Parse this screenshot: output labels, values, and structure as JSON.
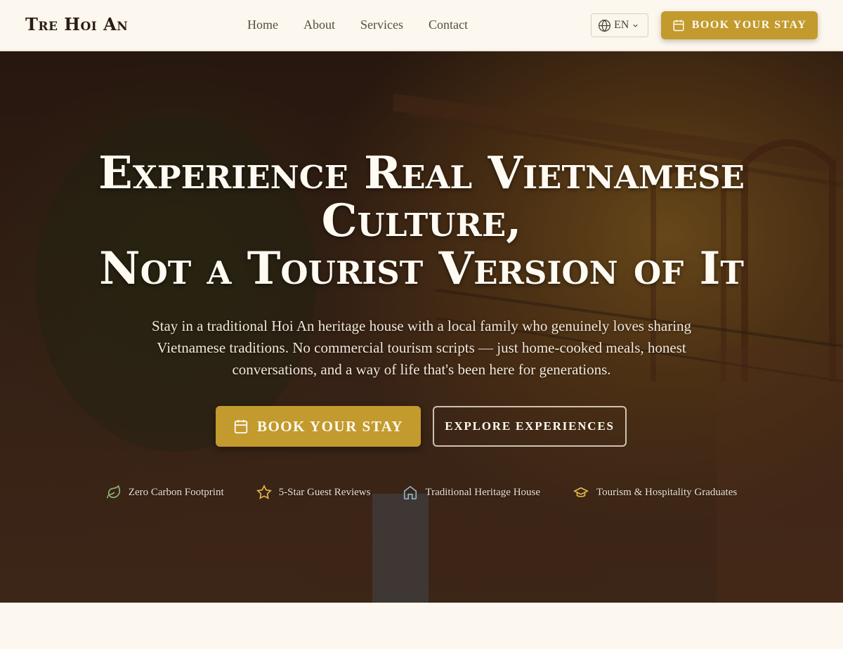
{
  "header": {
    "brand": "Tre Hoi An",
    "nav": [
      "Home",
      "About",
      "Services",
      "Contact"
    ],
    "language": "EN",
    "book_label": "BOOK YOUR STAY"
  },
  "hero": {
    "title_lines": [
      "Experience Real Vietnamese",
      "Culture,",
      "Not a Tourist Version of It"
    ],
    "subtitle": "Stay in a traditional Hoi An heritage house with a local family who genuinely loves sharing Vietnamese traditions. No commercial tourism scripts — just home-cooked meals, honest conversations, and a way of life that's been here for generations.",
    "book_label": "BOOK YOUR STAY",
    "explore_label": "EXPLORE EXPERIENCES",
    "features": [
      {
        "icon": "leaf-icon",
        "label": "Zero Carbon Footprint"
      },
      {
        "icon": "star-icon",
        "label": "5-Star Guest Reviews"
      },
      {
        "icon": "house-icon",
        "label": "Traditional Heritage House"
      },
      {
        "icon": "graduation-cap-icon",
        "label": "Tourism & Hospitality Graduates"
      }
    ]
  },
  "colors": {
    "accent_gold": "#c29a2e",
    "background_cream": "#fcf7ef",
    "brand_text": "#2b1d14",
    "leaf_green": "#8fb07a",
    "star_gold": "#e3b84a",
    "house_blue": "#8fb3c9"
  }
}
